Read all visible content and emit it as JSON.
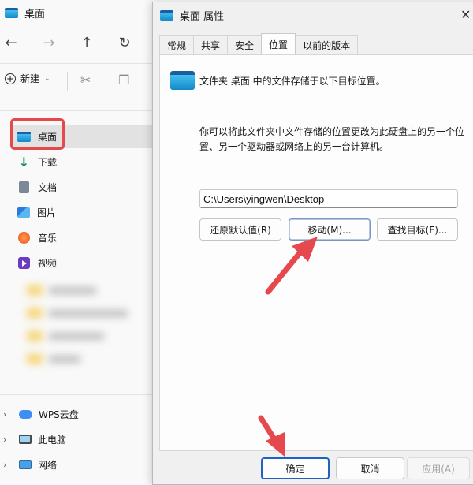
{
  "explorer": {
    "title": "桌面",
    "new_label": "新建",
    "quick_access": [
      {
        "label": "桌面",
        "icon": "desktop-icon"
      },
      {
        "label": "下载",
        "icon": "download-icon"
      },
      {
        "label": "文档",
        "icon": "document-icon"
      },
      {
        "label": "图片",
        "icon": "pictures-icon"
      },
      {
        "label": "音乐",
        "icon": "music-icon"
      },
      {
        "label": "视频",
        "icon": "video-icon"
      }
    ],
    "tree": [
      {
        "label": "WPS云盘",
        "icon": "cloud-icon"
      },
      {
        "label": "此电脑",
        "icon": "computer-icon"
      },
      {
        "label": "网络",
        "icon": "network-icon"
      }
    ]
  },
  "dialog": {
    "title": "桌面 属性",
    "tabs": [
      "常规",
      "共享",
      "安全",
      "位置",
      "以前的版本"
    ],
    "active_tab": "位置",
    "location_info": "文件夹 桌面 中的文件存储于以下目标位置。",
    "description": "你可以将此文件夹中文件存储的位置更改为此硬盘上的另一个位置、另一个驱动器或网络上的另一台计算机。",
    "path": "C:\\Users\\yingwen\\Desktop",
    "buttons": {
      "restore_default": "还原默认值(R)",
      "move": "移动(M)...",
      "find_target": "查找目标(F)..."
    },
    "footer": {
      "ok": "确定",
      "cancel": "取消",
      "apply": "应用(A)"
    }
  },
  "colors": {
    "annotation_red": "#e5484d",
    "accent_blue": "#1c63c3"
  }
}
